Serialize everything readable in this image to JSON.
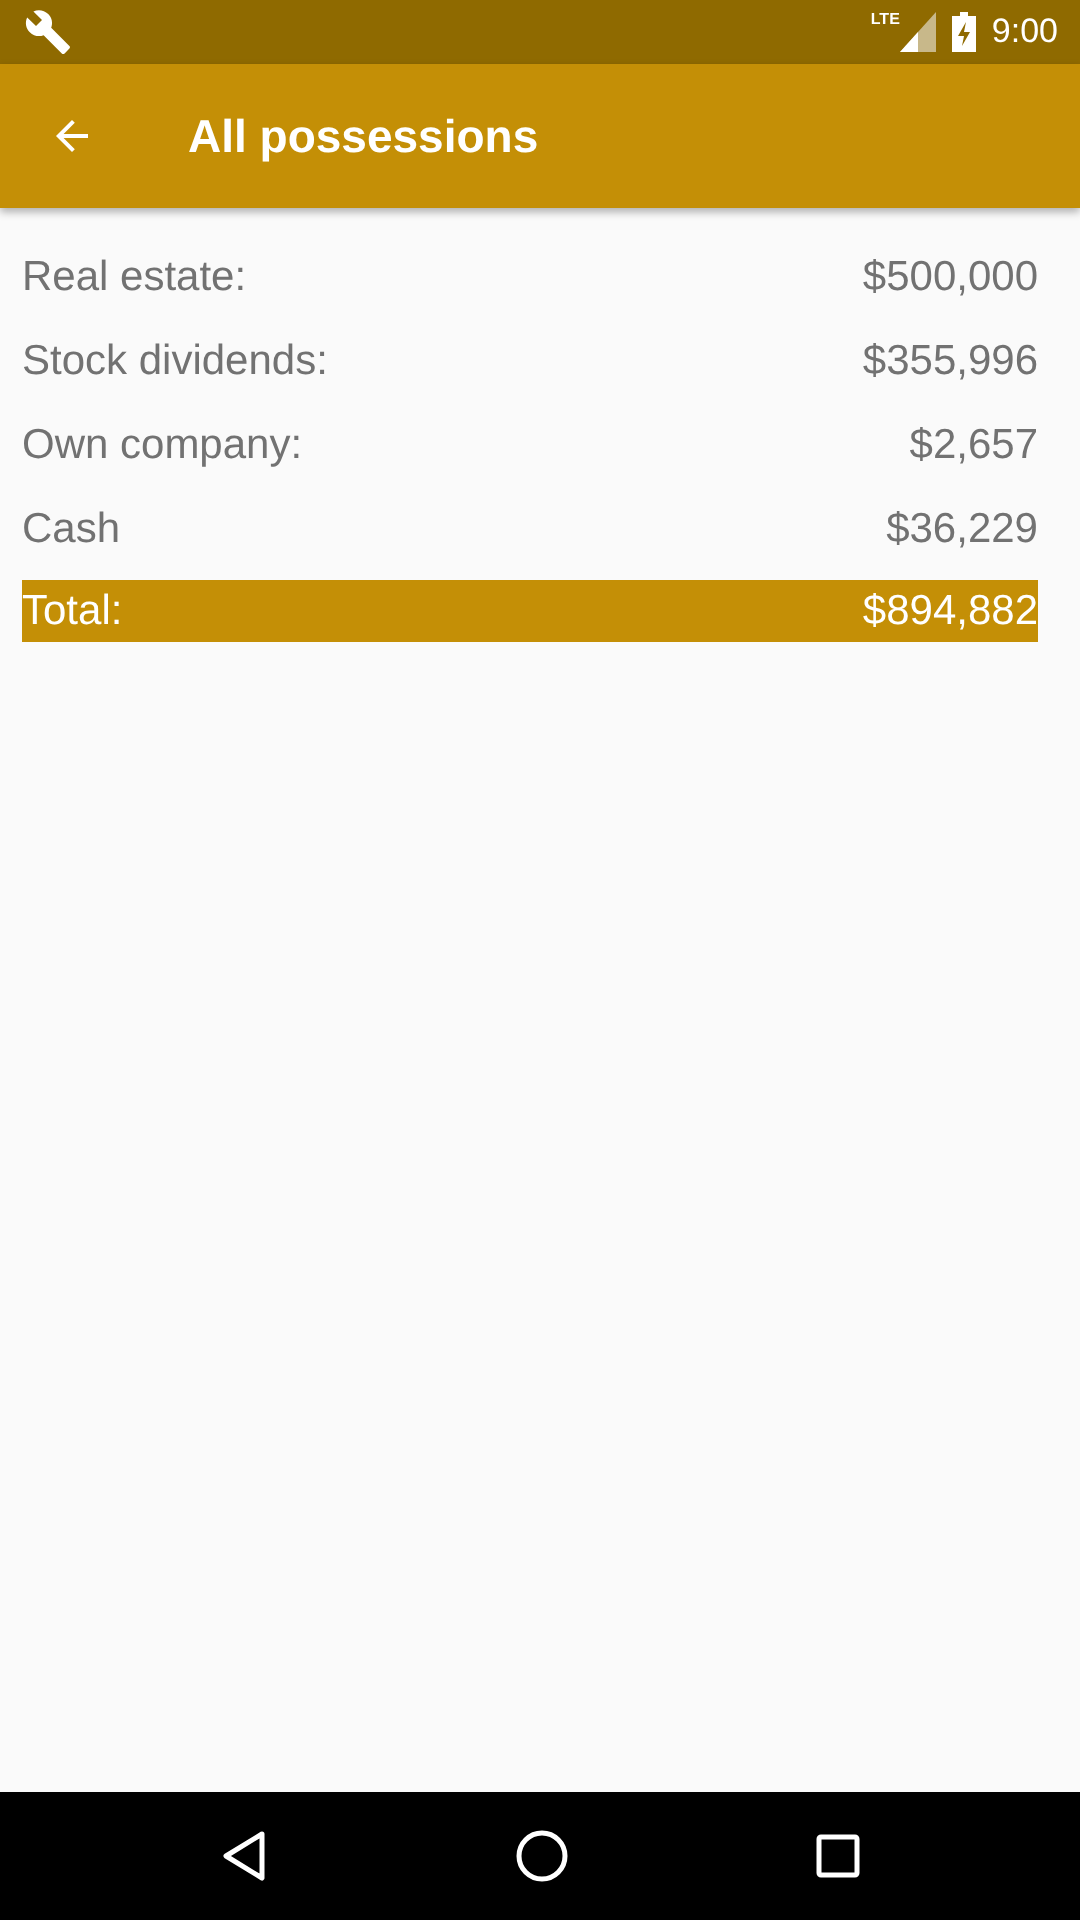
{
  "status_bar": {
    "network": "LTE",
    "time": "9:00"
  },
  "app_bar": {
    "title": "All possessions"
  },
  "rows": [
    {
      "kind": "item",
      "label": "Real estate:",
      "value": "$500,000"
    },
    {
      "kind": "item",
      "label": "Stock dividends:",
      "value": "$355,996"
    },
    {
      "kind": "item",
      "label": "Own company:",
      "value": "$2,657"
    },
    {
      "kind": "item",
      "label": "Cash",
      "value": "$36,229"
    },
    {
      "kind": "total",
      "label": "Total:",
      "value": "$894,882"
    }
  ]
}
